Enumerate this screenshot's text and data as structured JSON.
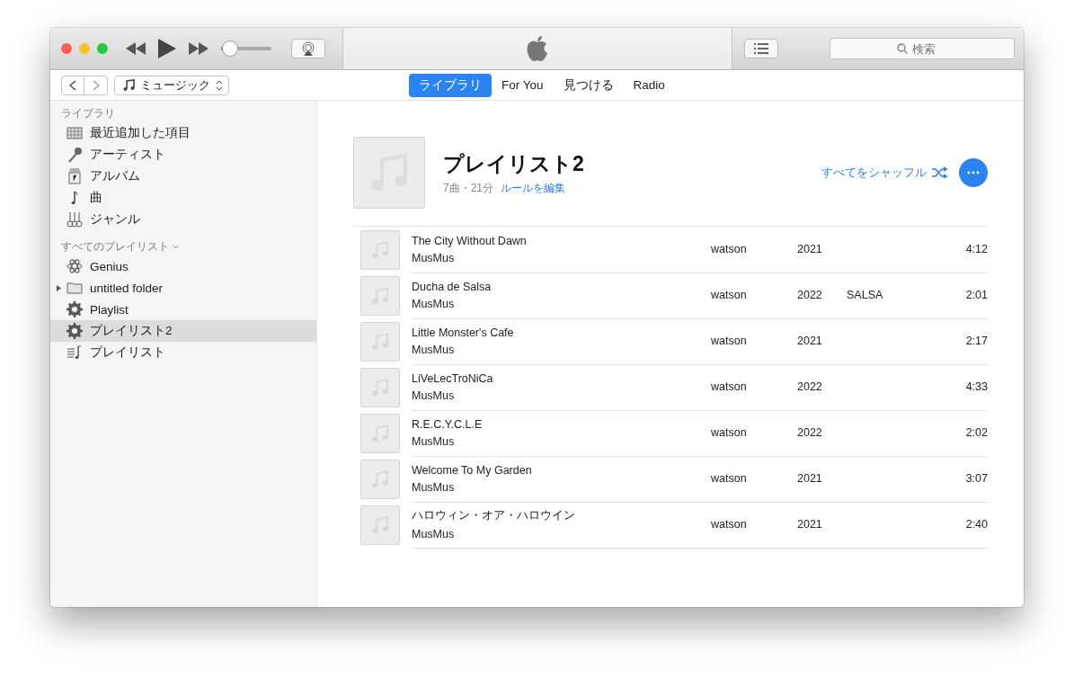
{
  "player": {
    "volume": {
      "level": 0.05
    }
  },
  "navigation": {
    "media_selector": "ミュージック",
    "search": {
      "placeholder": "検索"
    }
  },
  "tabs": [
    {
      "label": "ライブラリ",
      "selected": true
    },
    {
      "label": "For You",
      "selected": false
    },
    {
      "label": "見つける",
      "selected": false
    },
    {
      "label": "Radio",
      "selected": false
    }
  ],
  "sidebar": {
    "library_heading": "ライブラリ",
    "library_items": [
      {
        "label": "最近追加した項目",
        "kind": "grid",
        "selected": false
      },
      {
        "label": "アーティスト",
        "kind": "mic",
        "selected": false
      },
      {
        "label": "アルバム",
        "kind": "album",
        "selected": false
      },
      {
        "label": "曲",
        "kind": "note",
        "selected": false
      },
      {
        "label": "ジャンル",
        "kind": "genre",
        "selected": false
      }
    ],
    "playlists_heading": "すべてのプレイリスト",
    "playlist_items": [
      {
        "label": "Genius",
        "kind": "atom",
        "selected": false
      },
      {
        "label": "untitled folder",
        "kind": "folder",
        "selected": false
      },
      {
        "label": "Playlist",
        "kind": "gear",
        "selected": false
      },
      {
        "label": "プレイリスト2",
        "kind": "gear",
        "selected": true
      },
      {
        "label": "プレイリスト",
        "kind": "list",
        "selected": false
      }
    ]
  },
  "playlist": {
    "title": "プレイリスト2",
    "summary": "7曲・21分",
    "edit_rules": "ルールを編集",
    "shuffle": "すべてをシャッフル",
    "songs": [
      {
        "title": "The City Without Dawn",
        "artist": "MusMus",
        "column_3": "watson",
        "year": "2021",
        "time": "4:12"
      },
      {
        "title": "Ducha de Salsa",
        "artist": "MusMus",
        "column_3": "watson",
        "year": "2022",
        "genre": "SALSA",
        "time": "2:01"
      },
      {
        "title": "Little Monster's Cafe",
        "artist": "MusMus",
        "column_3": "watson",
        "year": "2021",
        "time": "2:17"
      },
      {
        "title": "LiVeLecTroNiCa",
        "artist": "MusMus",
        "column_3": "watson",
        "year": "2022",
        "time": "4:33"
      },
      {
        "title": "R.E.C.Y.C.L.E",
        "artist": "MusMus",
        "column_3": "watson",
        "year": "2022",
        "time": "2:02"
      },
      {
        "title": "Welcome To My Garden",
        "artist": "MusMus",
        "column_3": "watson",
        "year": "2021",
        "time": "3:07"
      },
      {
        "title": "ハロウィン・オア・ハロウイン",
        "artist": "MusMus",
        "column_3": "watson",
        "year": "2021",
        "time": "2:40"
      }
    ]
  }
}
